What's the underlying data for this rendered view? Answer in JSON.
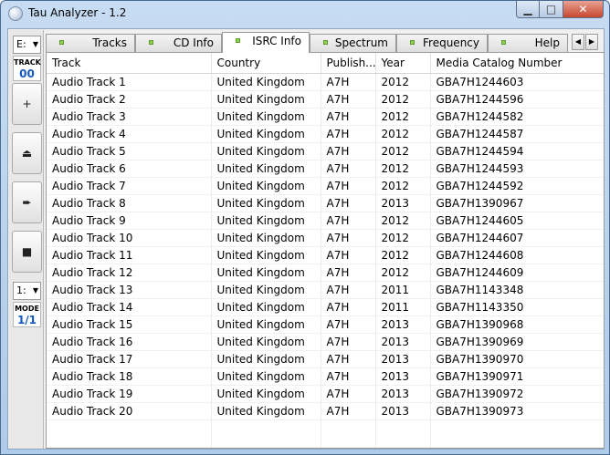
{
  "window": {
    "title": "Tau Analyzer - 1.2",
    "controls": {
      "min": "▁",
      "max": "□",
      "close": "✕"
    }
  },
  "sidebar": {
    "drive": "E:",
    "track_label": "TRACK",
    "track_value": "00",
    "buttons": [
      {
        "name": "add",
        "glyph": "+"
      },
      {
        "name": "eject",
        "glyph": "⏏"
      },
      {
        "name": "play",
        "glyph": "➨"
      },
      {
        "name": "stop",
        "glyph": "■"
      }
    ],
    "mode_select": "1:",
    "mode_label": "MODE",
    "mode_value": "1/1"
  },
  "tabs": [
    {
      "label": "Tracks"
    },
    {
      "label": "CD Info"
    },
    {
      "label": "ISRC Info",
      "active": true
    },
    {
      "label": "Spectrum"
    },
    {
      "label": "Frequency"
    },
    {
      "label": "Help"
    }
  ],
  "table": {
    "columns": [
      "Track",
      "Country",
      "Publish...",
      "Year",
      "Media Catalog Number"
    ],
    "rows": [
      [
        "Audio Track 1",
        "United Kingdom",
        "A7H",
        "2012",
        "GBA7H1244603"
      ],
      [
        "Audio Track 2",
        "United Kingdom",
        "A7H",
        "2012",
        "GBA7H1244596"
      ],
      [
        "Audio Track 3",
        "United Kingdom",
        "A7H",
        "2012",
        "GBA7H1244582"
      ],
      [
        "Audio Track 4",
        "United Kingdom",
        "A7H",
        "2012",
        "GBA7H1244587"
      ],
      [
        "Audio Track 5",
        "United Kingdom",
        "A7H",
        "2012",
        "GBA7H1244594"
      ],
      [
        "Audio Track 6",
        "United Kingdom",
        "A7H",
        "2012",
        "GBA7H1244593"
      ],
      [
        "Audio Track 7",
        "United Kingdom",
        "A7H",
        "2012",
        "GBA7H1244592"
      ],
      [
        "Audio Track 8",
        "United Kingdom",
        "A7H",
        "2013",
        "GBA7H1390967"
      ],
      [
        "Audio Track 9",
        "United Kingdom",
        "A7H",
        "2012",
        "GBA7H1244605"
      ],
      [
        "Audio Track 10",
        "United Kingdom",
        "A7H",
        "2012",
        "GBA7H1244607"
      ],
      [
        "Audio Track 11",
        "United Kingdom",
        "A7H",
        "2012",
        "GBA7H1244608"
      ],
      [
        "Audio Track 12",
        "United Kingdom",
        "A7H",
        "2012",
        "GBA7H1244609"
      ],
      [
        "Audio Track 13",
        "United Kingdom",
        "A7H",
        "2011",
        "GBA7H1143348"
      ],
      [
        "Audio Track 14",
        "United Kingdom",
        "A7H",
        "2011",
        "GBA7H1143350"
      ],
      [
        "Audio Track 15",
        "United Kingdom",
        "A7H",
        "2013",
        "GBA7H1390968"
      ],
      [
        "Audio Track 16",
        "United Kingdom",
        "A7H",
        "2013",
        "GBA7H1390969"
      ],
      [
        "Audio Track 17",
        "United Kingdom",
        "A7H",
        "2013",
        "GBA7H1390970"
      ],
      [
        "Audio Track 18",
        "United Kingdom",
        "A7H",
        "2013",
        "GBA7H1390971"
      ],
      [
        "Audio Track 19",
        "United Kingdom",
        "A7H",
        "2013",
        "GBA7H1390972"
      ],
      [
        "Audio Track 20",
        "United Kingdom",
        "A7H",
        "2013",
        "GBA7H1390973"
      ]
    ]
  },
  "colors": {
    "led": "#8fd14f",
    "counter_text": "#1558c0",
    "close_button": "#c7462f"
  }
}
